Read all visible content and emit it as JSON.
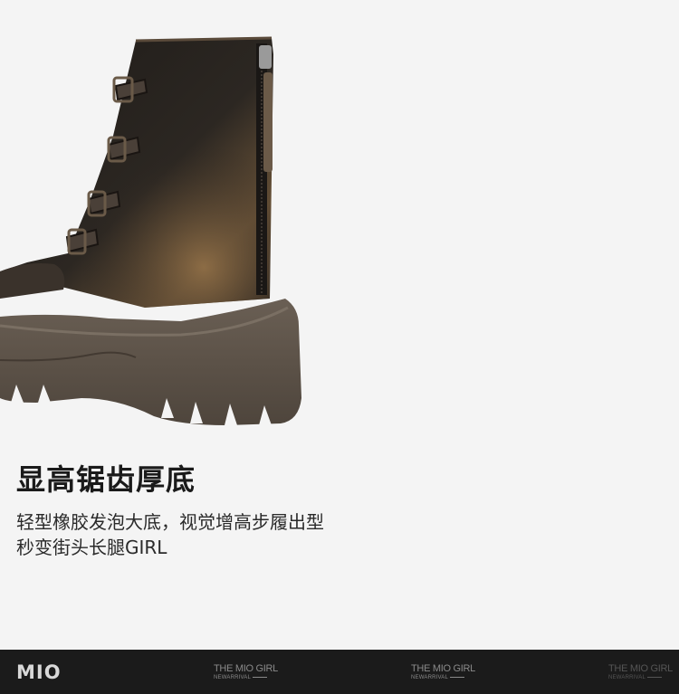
{
  "feature": {
    "headline": "显高锯齿厚底",
    "description_lines": [
      "轻型橡胶发泡大底，视觉增高步履出型",
      "秒变街头长腿GIRL"
    ]
  },
  "footer": {
    "brand_logo": "MIO",
    "watermarks": [
      {
        "title": "THE MIO GIRL",
        "subtitle": "NEWARRIVAL"
      },
      {
        "title": "THE MIO GIRL",
        "subtitle": "NEWARRIVAL"
      },
      {
        "title": "THE MIO GIRL",
        "subtitle": "NEWARRIVAL"
      }
    ]
  },
  "colors": {
    "background": "#f4f4f4",
    "footer_bg": "#1b1b1b",
    "boot_leather": "#2a2520",
    "sole": "#5a5046"
  }
}
